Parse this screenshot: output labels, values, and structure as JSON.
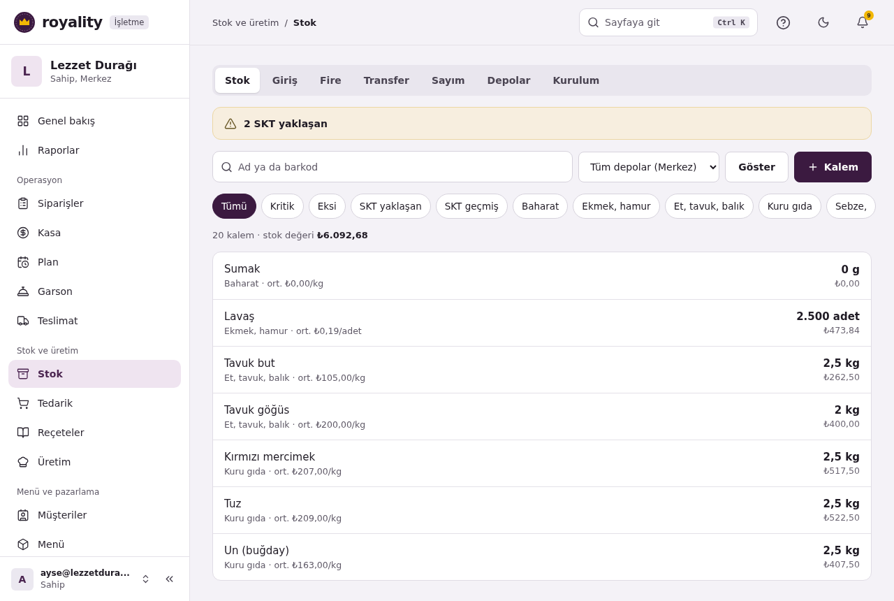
{
  "brand": {
    "name": "royality",
    "badge": "İşletme"
  },
  "business": {
    "initial": "L",
    "name": "Lezzet Durağı",
    "role": "Sahip, Merkez"
  },
  "nav": [
    {
      "kind": "item",
      "label": "Genel bakış",
      "selected": false
    },
    {
      "kind": "item",
      "label": "Raporlar",
      "selected": false
    },
    {
      "kind": "heading",
      "label": "Operasyon"
    },
    {
      "kind": "item",
      "label": "Siparişler",
      "selected": false
    },
    {
      "kind": "item",
      "label": "Kasa",
      "selected": false
    },
    {
      "kind": "item",
      "label": "Plan",
      "selected": false
    },
    {
      "kind": "item",
      "label": "Garson",
      "selected": false
    },
    {
      "kind": "item",
      "label": "Teslimat",
      "selected": false
    },
    {
      "kind": "heading",
      "label": "Stok ve üretim"
    },
    {
      "kind": "item",
      "label": "Stok",
      "selected": true
    },
    {
      "kind": "item",
      "label": "Tedarik",
      "selected": false
    },
    {
      "kind": "item",
      "label": "Reçeteler",
      "selected": false
    },
    {
      "kind": "item",
      "label": "Üretim",
      "selected": false
    },
    {
      "kind": "heading",
      "label": "Menü ve pazarlama"
    },
    {
      "kind": "item",
      "label": "Müşteriler",
      "selected": false
    },
    {
      "kind": "item",
      "label": "Menü",
      "selected": false
    }
  ],
  "user": {
    "initial": "A",
    "email": "ayse@lezzetdura...",
    "role": "Sahip"
  },
  "breadcrumb": [
    "Stok ve üretim",
    "/",
    "Stok"
  ],
  "search": {
    "placeholder": "Sayfaya git",
    "shortcut": "Ctrl K"
  },
  "notifications": {
    "count": "9"
  },
  "tabs": [
    {
      "label": "Stok",
      "selected": true
    },
    {
      "label": "Giriş",
      "selected": false
    },
    {
      "label": "Fire",
      "selected": false
    },
    {
      "label": "Transfer",
      "selected": false
    },
    {
      "label": "Sayım",
      "selected": false
    },
    {
      "label": "Depolar",
      "selected": false
    },
    {
      "label": "Kurulum",
      "selected": false
    }
  ],
  "alert": "2 SKT yaklaşan",
  "filter": {
    "placeholder": "Ad ya da barkod",
    "warehouse": "Tüm depolar (Merkez)",
    "show_button": "Göster",
    "add_button": "Kalem"
  },
  "chips": [
    {
      "label": "Tümü",
      "selected": true
    },
    {
      "label": "Kritik",
      "selected": false
    },
    {
      "label": "Eksi",
      "selected": false
    },
    {
      "label": "SKT yaklaşan",
      "selected": false
    },
    {
      "label": "SKT geçmiş",
      "selected": false
    },
    {
      "label": "Baharat",
      "selected": false
    },
    {
      "label": "Ekmek, hamur",
      "selected": false
    },
    {
      "label": "Et, tavuk, balık",
      "selected": false
    },
    {
      "label": "Kuru gıda",
      "selected": false
    },
    {
      "label": "Sebze,",
      "selected": false
    }
  ],
  "summary": {
    "text": "20 kalem · stok değeri",
    "value": "₺6.092,68"
  },
  "items": [
    {
      "name": "Sumak",
      "detail": "Baharat · ort. ₺0,00/kg",
      "quantity": "0 g",
      "value": "₺0,00"
    },
    {
      "name": "Lavaş",
      "detail": "Ekmek, hamur · ort. ₺0,19/adet",
      "quantity": "2.500 adet",
      "value": "₺473,84"
    },
    {
      "name": "Tavuk but",
      "detail": "Et, tavuk, balık · ort. ₺105,00/kg",
      "quantity": "2,5 kg",
      "value": "₺262,50"
    },
    {
      "name": "Tavuk göğüs",
      "detail": "Et, tavuk, balık · ort. ₺200,00/kg",
      "quantity": "2 kg",
      "value": "₺400,00"
    },
    {
      "name": "Kırmızı mercimek",
      "detail": "Kuru gıda · ort. ₺207,00/kg",
      "quantity": "2,5 kg",
      "value": "₺517,50"
    },
    {
      "name": "Tuz",
      "detail": "Kuru gıda · ort. ₺209,00/kg",
      "quantity": "2,5 kg",
      "value": "₺522,50"
    },
    {
      "name": "Un (buğday)",
      "detail": "Kuru gıda · ort. ₺163,00/kg",
      "quantity": "2,5 kg",
      "value": "₺407,50"
    }
  ]
}
